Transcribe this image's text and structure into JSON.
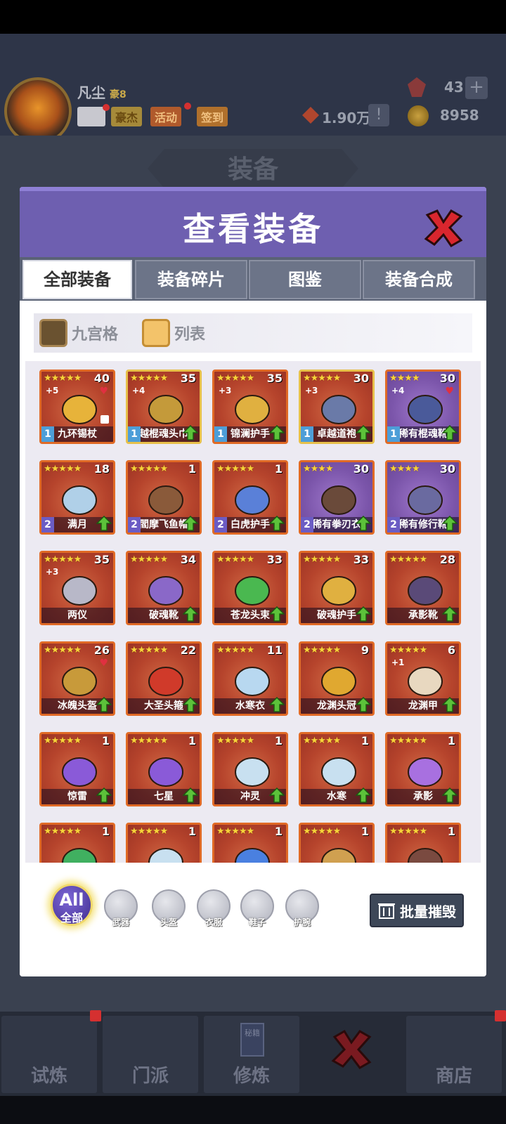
{
  "player": {
    "name": "凡尘",
    "tag": "豪8"
  },
  "top_buttons": [
    "豪杰",
    "活动",
    "签到"
  ],
  "resources": {
    "gems": "43",
    "power": "1.90万",
    "coins": "8958"
  },
  "background_title": "装备",
  "dialog": {
    "title": "查看装备",
    "tabs": [
      "全部装备",
      "装备碎片",
      "图鉴",
      "装备合成"
    ],
    "view_modes": [
      "九宫格",
      "列表"
    ]
  },
  "items": [
    {
      "name": "九环锡杖",
      "level": "40",
      "stars": "★★★★★",
      "plus": "+5",
      "badge": "1",
      "bg": "red",
      "heart": true,
      "lock": true,
      "up": false
    },
    {
      "name": "越棍魂头巾",
      "level": "35",
      "stars": "★★★★★",
      "plus": "+4",
      "badge": "1",
      "bg": "red",
      "gold": true,
      "up": true
    },
    {
      "name": "锦澜护手",
      "level": "35",
      "stars": "★★★★★",
      "plus": "+3",
      "badge": "1",
      "bg": "red",
      "up": true
    },
    {
      "name": "卓越道袍",
      "level": "30",
      "stars": "★★★★★",
      "plus": "+3",
      "badge": "1",
      "bg": "red",
      "gold": true,
      "up": true
    },
    {
      "name": "稀有棍魂靴",
      "level": "30",
      "stars": "★★★★",
      "plus": "+4",
      "badge": "1",
      "bg": "purple",
      "heart": true,
      "up": true
    },
    {
      "name": "满月",
      "level": "18",
      "stars": "★★★★★",
      "plus": "",
      "badge": "2",
      "bg": "red",
      "up": true
    },
    {
      "name": "閻摩飞鱼帽",
      "level": "1",
      "stars": "★★★★★",
      "plus": "",
      "badge": "2",
      "bg": "red",
      "up": true
    },
    {
      "name": "白虎护手",
      "level": "1",
      "stars": "★★★★★",
      "plus": "",
      "badge": "2",
      "bg": "red",
      "up": true
    },
    {
      "name": "稀有拳刃衣",
      "level": "30",
      "stars": "★★★★",
      "plus": "",
      "badge": "2",
      "bg": "purple",
      "up": true
    },
    {
      "name": "稀有修行靴",
      "level": "30",
      "stars": "★★★★",
      "plus": "",
      "badge": "2",
      "bg": "purple",
      "up": true
    },
    {
      "name": "两仪",
      "level": "35",
      "stars": "★★★★★",
      "plus": "+3",
      "badge": "",
      "bg": "red",
      "up": false
    },
    {
      "name": "破魂靴",
      "level": "34",
      "stars": "★★★★★",
      "plus": "",
      "badge": "",
      "bg": "red",
      "up": true
    },
    {
      "name": "苍龙头束",
      "level": "33",
      "stars": "★★★★★",
      "plus": "",
      "badge": "",
      "bg": "red",
      "up": true
    },
    {
      "name": "破魂护手",
      "level": "33",
      "stars": "★★★★★",
      "plus": "",
      "badge": "",
      "bg": "red",
      "up": true
    },
    {
      "name": "承影靴",
      "level": "28",
      "stars": "★★★★★",
      "plus": "",
      "badge": "",
      "bg": "red",
      "up": true
    },
    {
      "name": "冰魄头盔",
      "level": "26",
      "stars": "★★★★★",
      "plus": "",
      "badge": "",
      "bg": "red",
      "heart": true,
      "up": true
    },
    {
      "name": "大圣头箍",
      "level": "22",
      "stars": "★★★★★",
      "plus": "",
      "badge": "",
      "bg": "red",
      "up": true
    },
    {
      "name": "水寒衣",
      "level": "11",
      "stars": "★★★★★",
      "plus": "",
      "badge": "",
      "bg": "red",
      "up": true
    },
    {
      "name": "龙渊头冠",
      "level": "9",
      "stars": "★★★★★",
      "plus": "",
      "badge": "",
      "bg": "red",
      "up": true
    },
    {
      "name": "龙渊甲",
      "level": "6",
      "stars": "★★★★★",
      "plus": "+1",
      "badge": "",
      "bg": "red",
      "up": true
    },
    {
      "name": "惊雷",
      "level": "1",
      "stars": "★★★★★",
      "plus": "",
      "badge": "",
      "bg": "red",
      "up": true
    },
    {
      "name": "七星",
      "level": "1",
      "stars": "★★★★★",
      "plus": "",
      "badge": "",
      "bg": "red",
      "up": true
    },
    {
      "name": "冲灵",
      "level": "1",
      "stars": "★★★★★",
      "plus": "",
      "badge": "",
      "bg": "red",
      "up": true
    },
    {
      "name": "水寒",
      "level": "1",
      "stars": "★★★★★",
      "plus": "",
      "badge": "",
      "bg": "red",
      "up": true
    },
    {
      "name": "承影",
      "level": "1",
      "stars": "★★★★★",
      "plus": "",
      "badge": "",
      "bg": "red",
      "up": true
    },
    {
      "name": "",
      "level": "1",
      "stars": "★★★★★",
      "plus": "",
      "badge": "",
      "bg": "red",
      "up": false
    },
    {
      "name": "",
      "level": "1",
      "stars": "★★★★★",
      "plus": "",
      "badge": "",
      "bg": "red",
      "up": false
    },
    {
      "name": "",
      "level": "1",
      "stars": "★★★★★",
      "plus": "",
      "badge": "",
      "bg": "red",
      "up": false
    },
    {
      "name": "",
      "level": "1",
      "stars": "★★★★★",
      "plus": "",
      "badge": "",
      "bg": "red",
      "up": false
    },
    {
      "name": "",
      "level": "1",
      "stars": "★★★★★",
      "plus": "",
      "badge": "",
      "bg": "red",
      "up": false
    }
  ],
  "filters": {
    "all_top": "All",
    "all_bottom": "全部",
    "categories": [
      "武器",
      "头盔",
      "衣服",
      "鞋子",
      "护腕"
    ]
  },
  "destroy_label": "批量摧毁",
  "nav": [
    "试炼",
    "门派",
    "修炼",
    "",
    "商店"
  ],
  "nav_book_label": "秘籍",
  "colors": {
    "header": "#6e5fb0",
    "item_red": "#b6442c",
    "item_purple": "#7b55aa",
    "upgrade": "#5cc23a",
    "badge1": "#4d9ed8",
    "badge2": "#6b5cc4"
  }
}
